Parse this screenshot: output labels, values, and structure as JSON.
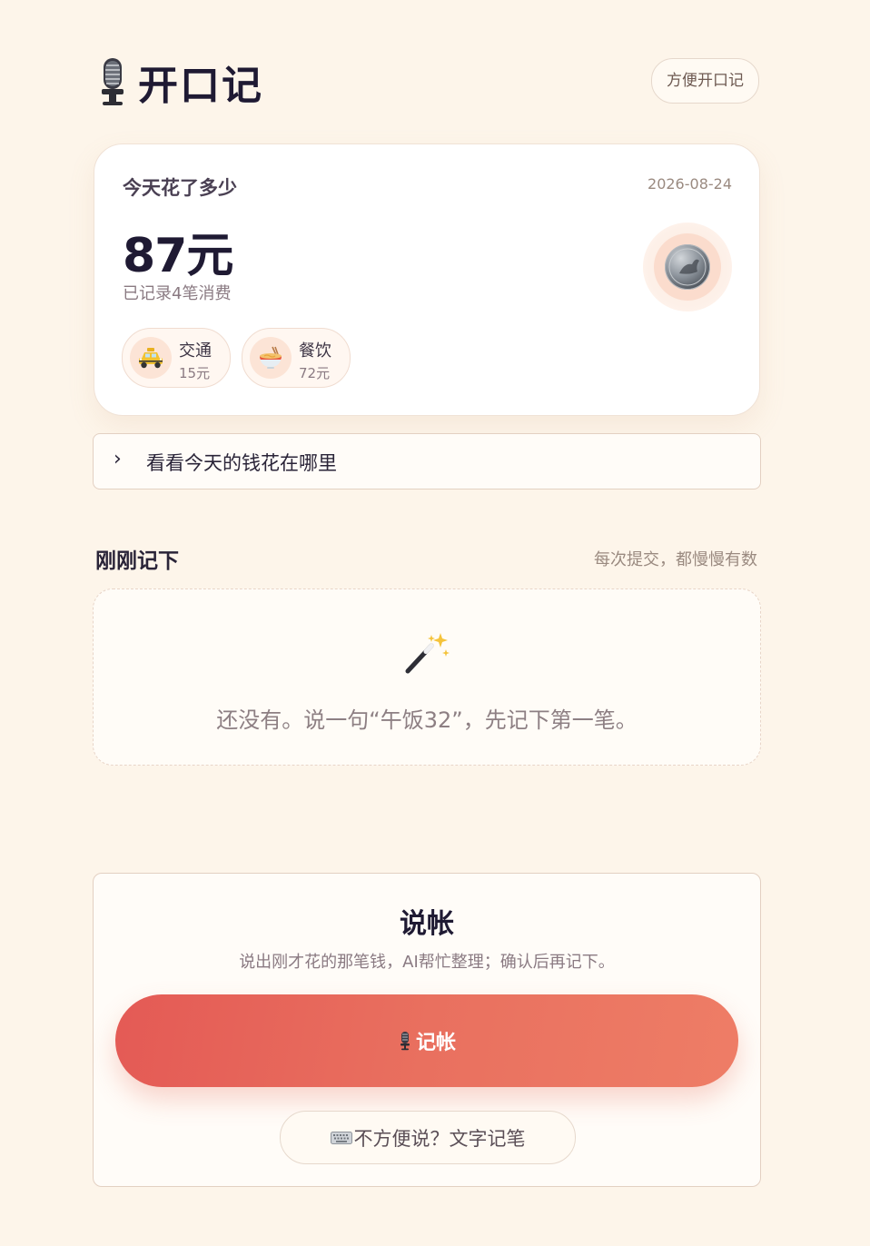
{
  "header": {
    "app_title": "开口记",
    "pill_label": "方便开口记"
  },
  "summary": {
    "label": "今天花了多少",
    "date": "2026-08-24",
    "amount": "87元",
    "count_text": "已记录4笔消费",
    "categories": [
      {
        "icon": "taxi-icon",
        "name": "交通",
        "amount": "15元"
      },
      {
        "icon": "noodle-bowl-icon",
        "name": "餐饮",
        "amount": "72元"
      }
    ]
  },
  "expander": {
    "label": "看看今天的钱花在哪里"
  },
  "recent": {
    "title": "刚刚记下",
    "hint": "每次提交，都慢慢有数",
    "empty_text": "还没有。说一句“午饭32”，先记下第一笔。"
  },
  "voice": {
    "title": "说帐",
    "subtitle": "说出刚才花的那笔钱，AI帮忙整理；确认后再记下。",
    "record_label": "记帐",
    "text_button_label": "不方便说？文字记笔"
  },
  "colors": {
    "background": "#fdf5ea",
    "accent_start": "#e45a55",
    "accent_end": "#ee7d66",
    "title": "#1f1a33"
  }
}
